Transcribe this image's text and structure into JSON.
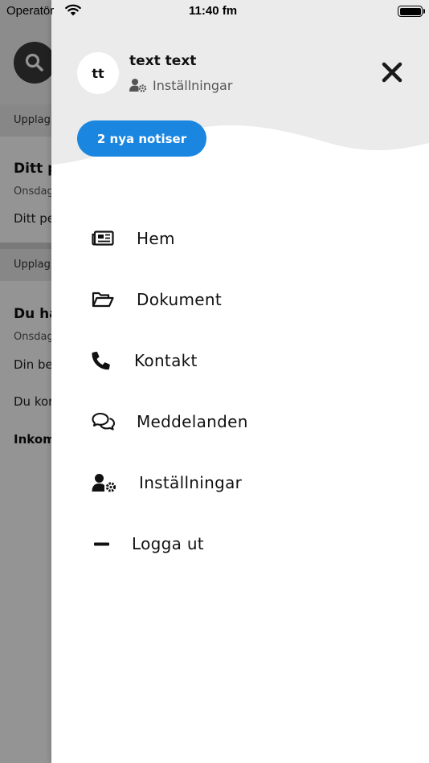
{
  "status_bar": {
    "carrier": "Operatör",
    "time": "11:40 fm"
  },
  "background": {
    "strip_1": "Upplag",
    "card_1_title": "Ditt p",
    "card_1_date": "Onsdag",
    "card_1_body": "Ditt pe",
    "strip_2": "Upplag",
    "card_2_title": "Du ha",
    "card_2_date": "Onsdag",
    "card_2_line_1": "Din be",
    "card_2_line_2": "Du kor",
    "card_2_line_3": "Inkom"
  },
  "drawer": {
    "avatar_initials": "tt",
    "user_name": "text text",
    "settings_link": "Inställningar",
    "notifications_button": "2 nya notiser",
    "menu": [
      {
        "label": "Hem",
        "icon": "newspaper-icon"
      },
      {
        "label": "Dokument",
        "icon": "folder-open-icon"
      },
      {
        "label": "Kontakt",
        "icon": "phone-icon"
      },
      {
        "label": "Meddelanden",
        "icon": "chat-bubbles-icon"
      },
      {
        "label": "Inställningar",
        "icon": "user-settings-icon"
      },
      {
        "label": "Logga ut",
        "icon": "minus-icon"
      }
    ]
  },
  "colors": {
    "accent": "#1a86e0",
    "header_bg": "#ebebeb",
    "overlay": "#8c8c8c"
  }
}
